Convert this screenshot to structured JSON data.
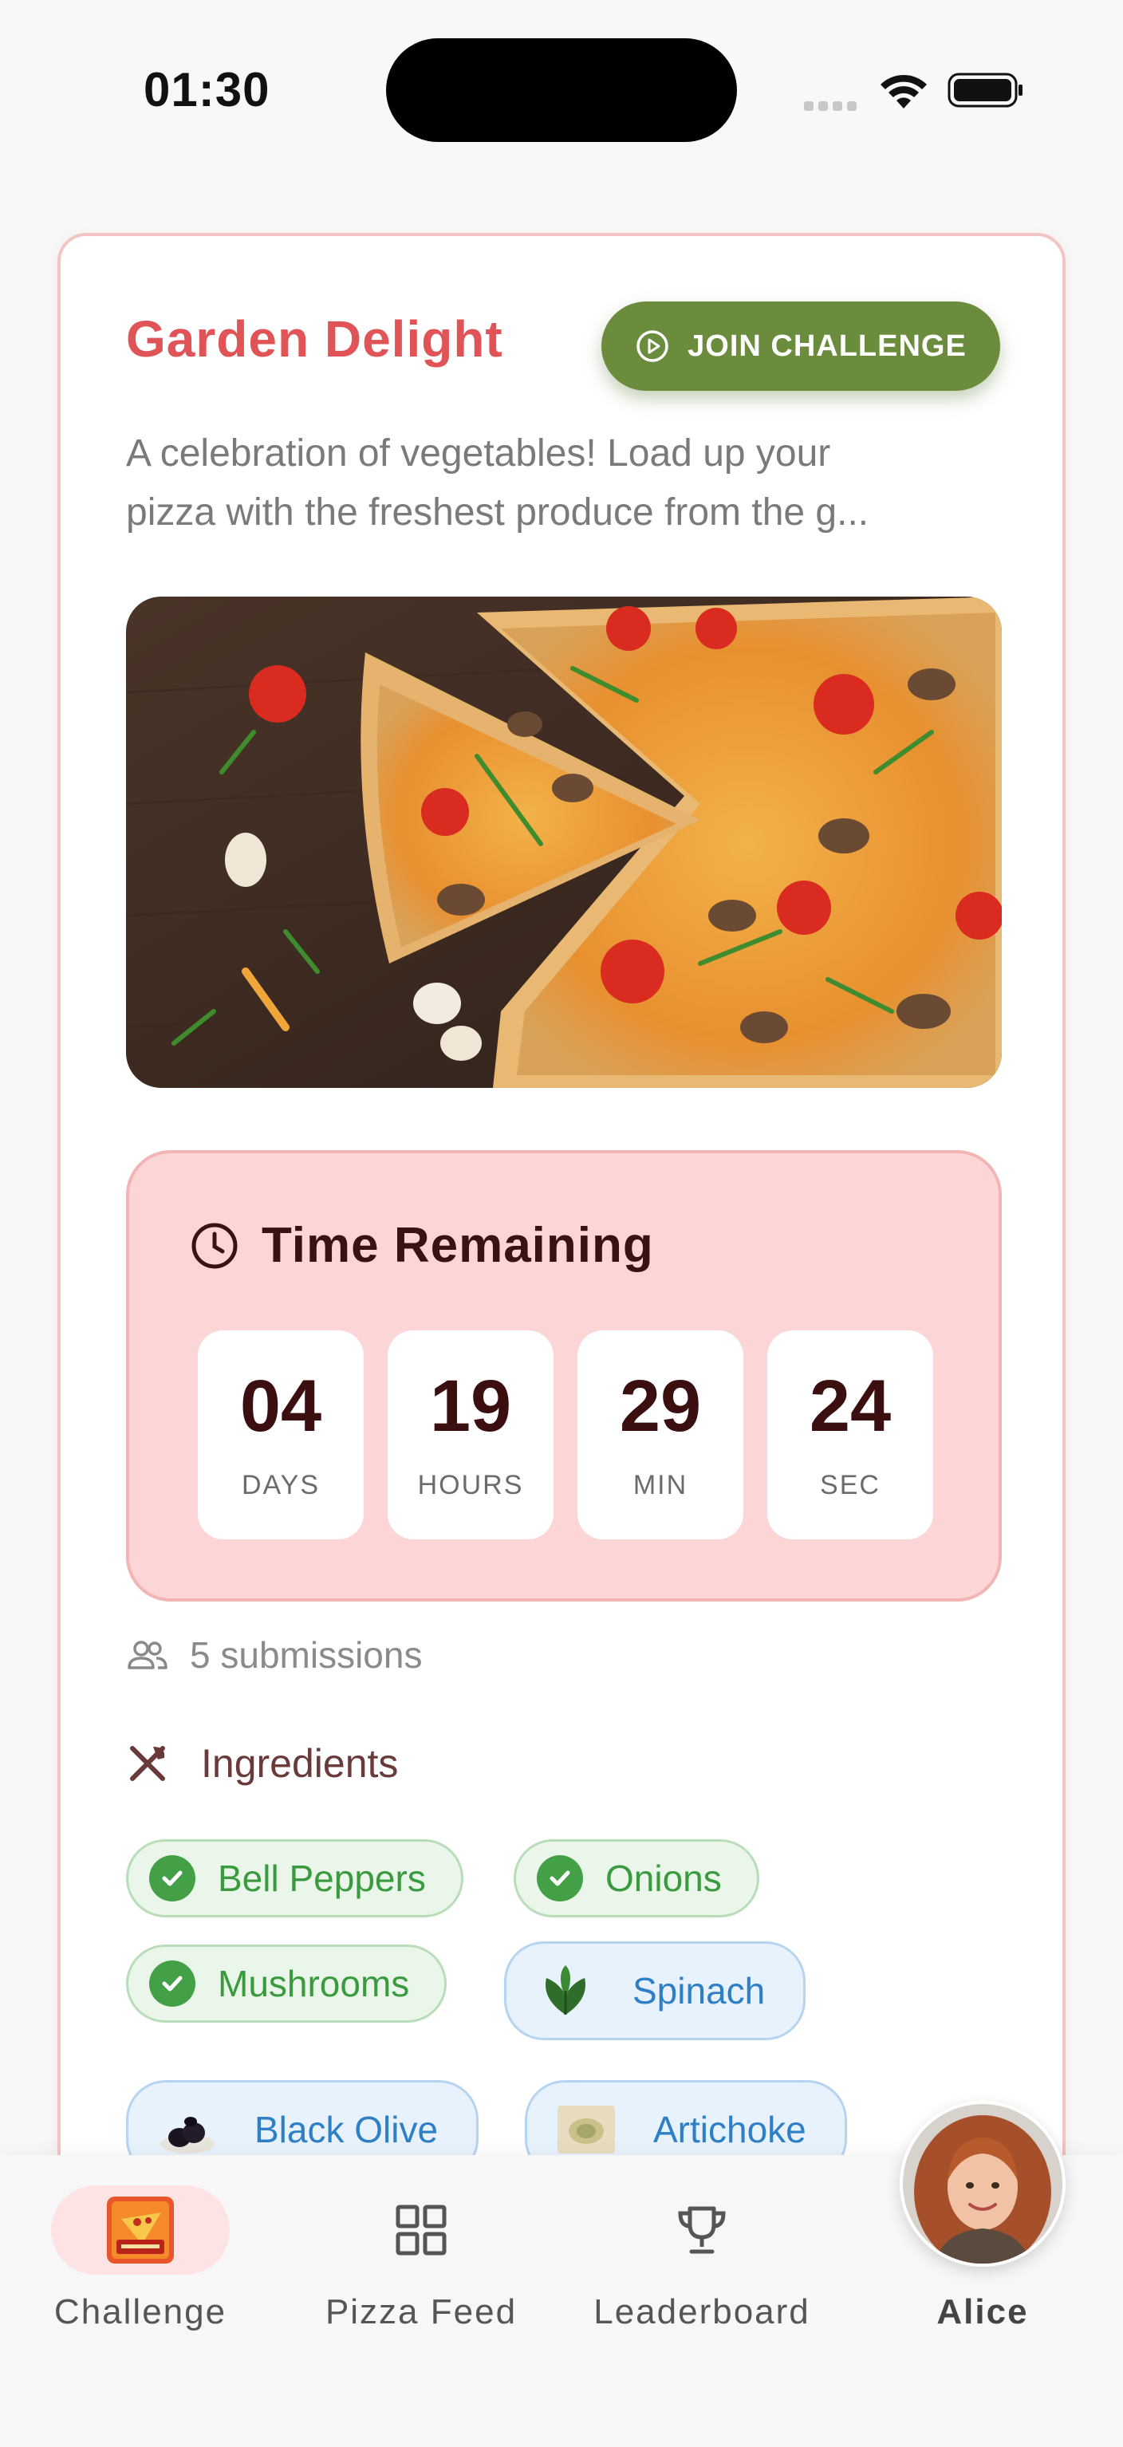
{
  "status_bar": {
    "time": "01:30",
    "icons": [
      "signal-dots-icon",
      "wifi-icon",
      "battery-icon"
    ]
  },
  "challenge": {
    "title": "Garden Delight",
    "join_button_label": "JOIN CHALLENGE",
    "description_line1": "A celebration of vegetables! Load up your",
    "description_line2": "pizza with the freshest produce from the g...",
    "photo_icon": "pizza-photo",
    "timer": {
      "title": "Time Remaining",
      "units": [
        {
          "value": "04",
          "label": "DAYS"
        },
        {
          "value": "19",
          "label": "HOURS"
        },
        {
          "value": "29",
          "label": "MIN"
        },
        {
          "value": "24",
          "label": "SEC"
        }
      ]
    },
    "submissions": "5 submissions",
    "ingredients_title": "Ingredients",
    "ingredients": [
      {
        "label": "Bell Peppers",
        "selected": true
      },
      {
        "label": "Onions",
        "selected": true
      },
      {
        "label": "Mushrooms",
        "selected": true
      },
      {
        "label": "Spinach",
        "selected": false,
        "icon": "spinach-icon"
      },
      {
        "label": "Black Olive",
        "selected": false,
        "icon": "black-olive-icon"
      },
      {
        "label": "Artichoke",
        "selected": false,
        "icon": "artichoke-icon"
      }
    ]
  },
  "nav": {
    "items": [
      {
        "label": "Challenge",
        "icon": "pizza-challenge-icon",
        "active": true
      },
      {
        "label": "Pizza Feed",
        "icon": "grid-icon",
        "active": false
      },
      {
        "label": "Leaderboard",
        "icon": "trophy-icon",
        "active": false
      },
      {
        "label": "Alice",
        "icon": "avatar",
        "active": false
      }
    ]
  },
  "colors": {
    "accent_red": "#e05356",
    "join_green": "#6b8c3d",
    "timer_bg": "#fcd6d6",
    "chip_green": "#3a9a3e",
    "chip_blue": "#2e7fc6"
  }
}
